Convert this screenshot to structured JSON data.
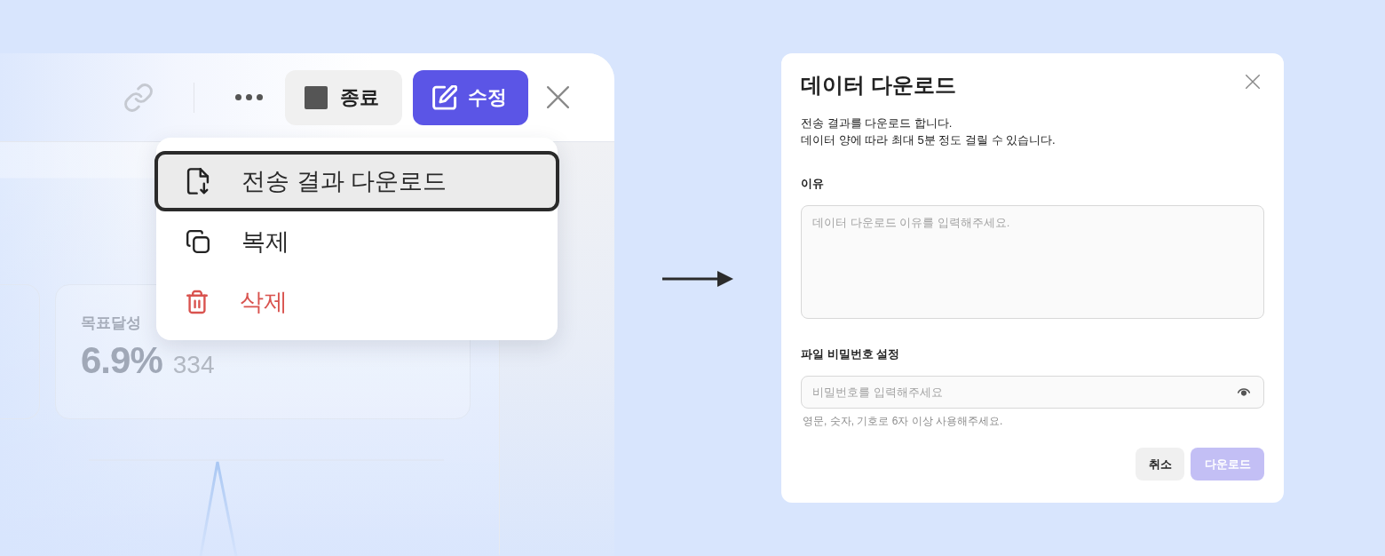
{
  "background_app": {
    "toolbar": {
      "buttons": [
        {
          "kind": "stop",
          "label": "종료"
        },
        {
          "kind": "edit",
          "label": "수정"
        }
      ]
    },
    "metric_card": {
      "label": "목표달성",
      "value": "6.9%",
      "count": "334"
    },
    "menu": {
      "items": [
        {
          "kind": "download",
          "label": "전송 결과 다운로드",
          "selected": true
        },
        {
          "kind": "duplicate",
          "label": "복제",
          "selected": false
        },
        {
          "kind": "delete",
          "label": "삭제",
          "selected": false
        }
      ]
    }
  },
  "dialog": {
    "title": "데이터 다운로드",
    "description": [
      "전송 결과를 다운로드 합니다.",
      "데이터 양에 따라 최대 5분 정도 걸릴 수 있습니다."
    ],
    "fields": [
      {
        "kind": "textarea",
        "label": "이유",
        "placeholder": "데이터 다운로드 이유를 입력해주세요."
      },
      {
        "kind": "password",
        "label": "파일 비밀번호 설정",
        "placeholder": "비밀번호를 입력해주세요",
        "hint": "영문, 숫자, 기호로 6자 이상 사용해주세요."
      }
    ],
    "buttons": [
      {
        "kind": "secondary",
        "label": "취소",
        "disabled": false
      },
      {
        "kind": "primary",
        "label": "다운로드",
        "disabled": true
      }
    ]
  }
}
